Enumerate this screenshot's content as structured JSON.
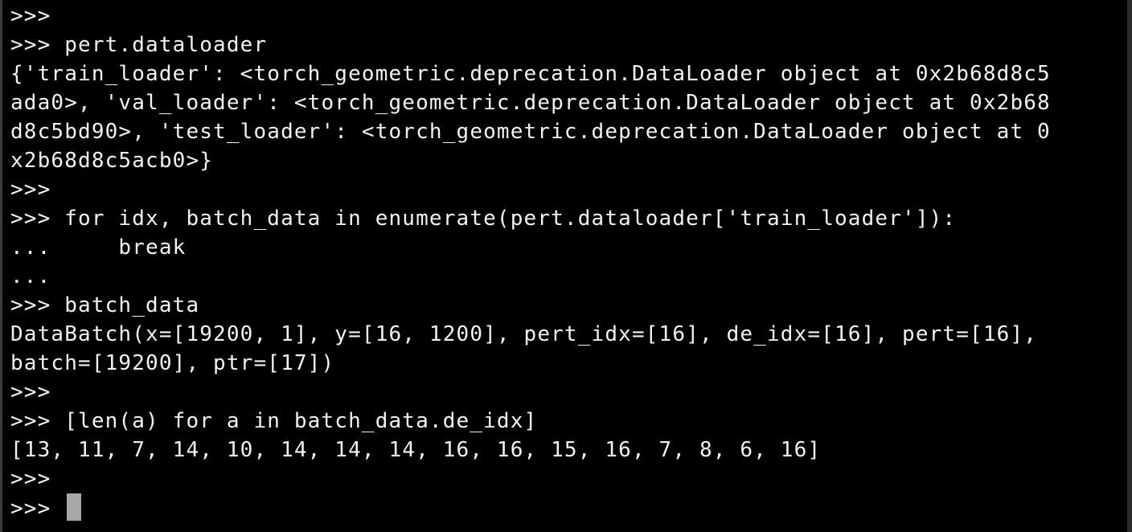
{
  "terminal": {
    "lines": [
      ">>>",
      ">>> pert.dataloader",
      "{'train_loader': <torch_geometric.deprecation.DataLoader object at 0x2b68d8c5",
      "ada0>, 'val_loader': <torch_geometric.deprecation.DataLoader object at 0x2b68",
      "d8c5bd90>, 'test_loader': <torch_geometric.deprecation.DataLoader object at 0",
      "x2b68d8c5acb0>}",
      ">>>",
      ">>> for idx, batch_data in enumerate(pert.dataloader['train_loader']):",
      "...     break",
      "...",
      ">>> batch_data",
      "DataBatch(x=[19200, 1], y=[16, 1200], pert_idx=[16], de_idx=[16], pert=[16],",
      "batch=[19200], ptr=[17])",
      ">>>",
      ">>> [len(a) for a in batch_data.de_idx]",
      "[13, 11, 7, 14, 10, 14, 14, 14, 16, 16, 15, 16, 7, 8, 6, 16]",
      ">>>"
    ],
    "prompt": ">>> "
  },
  "colors": {
    "background": "#000000",
    "text": "#f2f2f2",
    "cursor": "#a8a8a8"
  }
}
